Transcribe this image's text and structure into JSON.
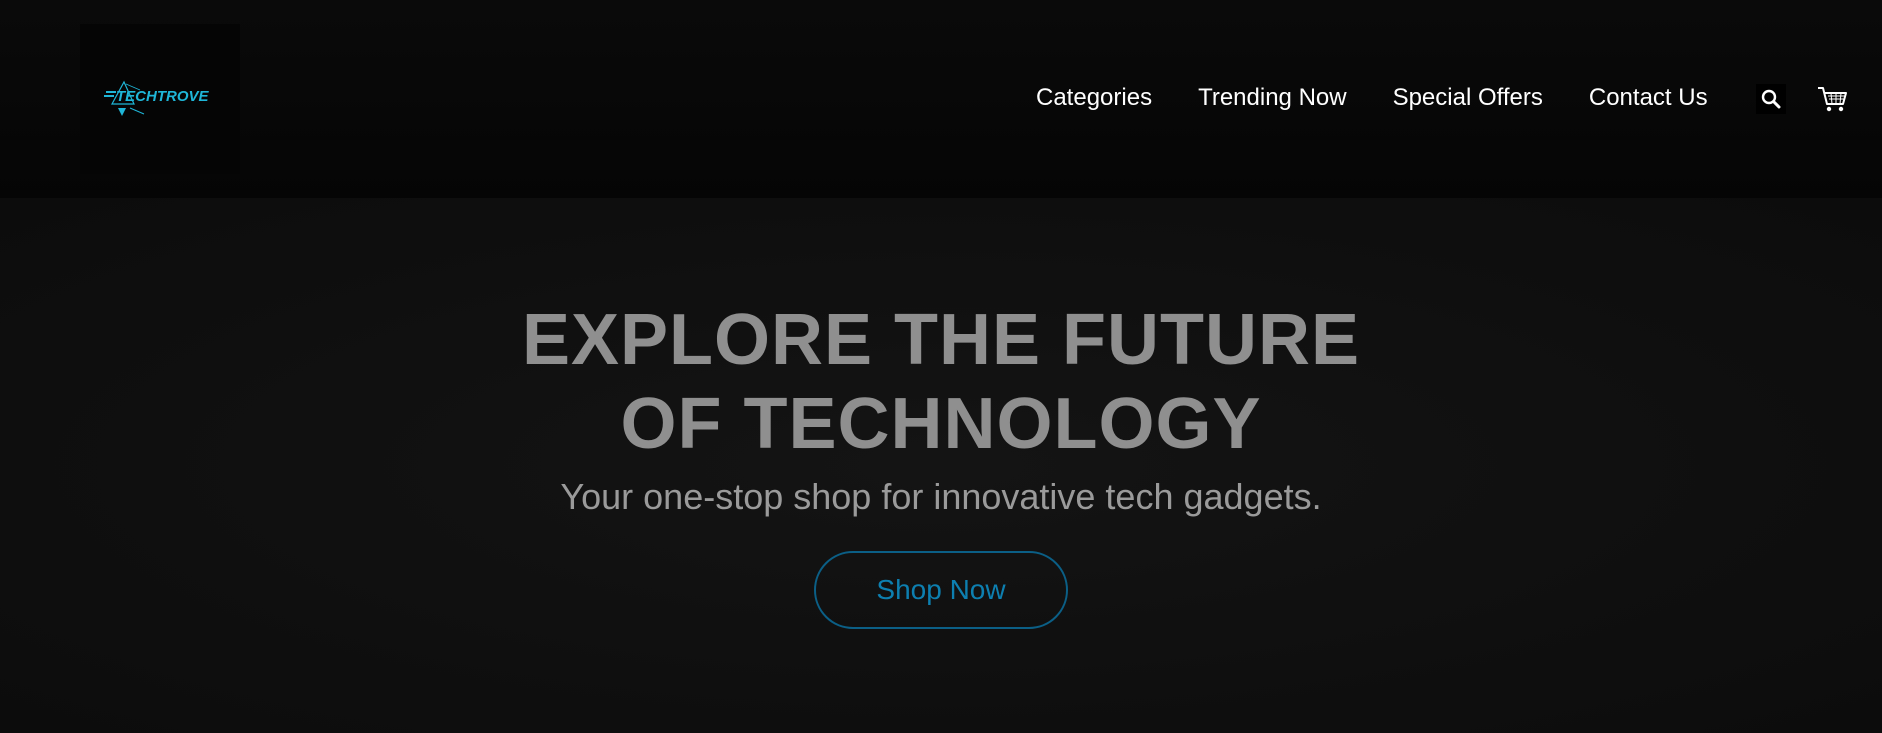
{
  "brand": {
    "logo_text": "TECHTROVE",
    "accent_color": "#1fb6d8"
  },
  "nav": {
    "items": [
      {
        "label": "Categories"
      },
      {
        "label": "Trending Now"
      },
      {
        "label": "Special Offers"
      },
      {
        "label": "Contact Us"
      }
    ],
    "search_icon": "search-icon",
    "cart_icon": "cart-icon"
  },
  "hero": {
    "title_line1": "EXPLORE THE FUTURE",
    "title_line2": "OF TECHNOLOGY",
    "subtitle": "Your one-stop shop for innovative tech gadgets.",
    "cta_label": "Shop Now",
    "cta_color": "#0d7fb0"
  },
  "colors": {
    "header_bg": "#080808",
    "hero_bg": "#0f0f0f",
    "title_color": "#8f8f8f",
    "nav_text": "#ffffff"
  }
}
